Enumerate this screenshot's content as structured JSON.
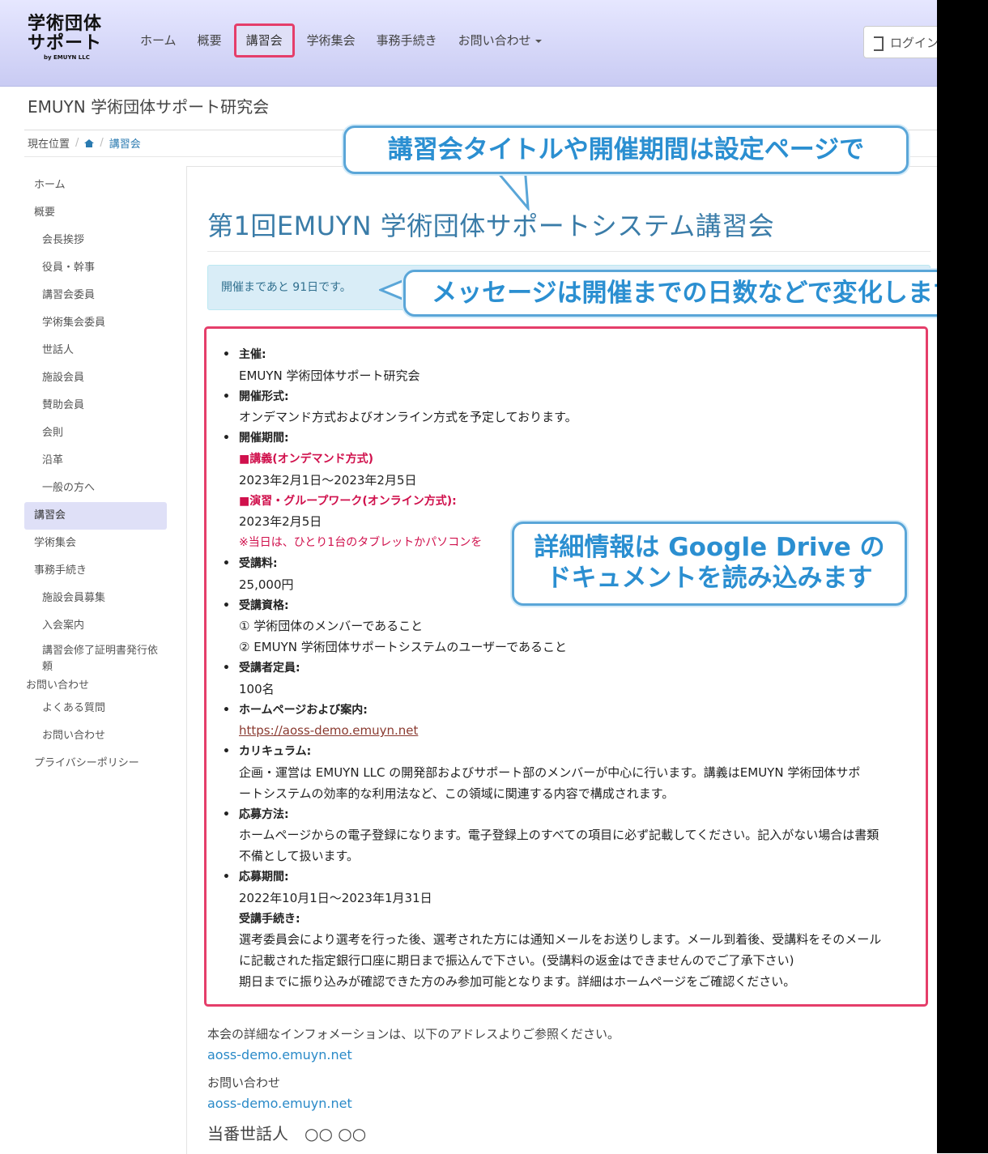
{
  "navbar": {
    "logo_line1": "学術団体",
    "logo_line2": "サポート",
    "logo_line3": "by EMUYN LLC",
    "items": [
      "ホーム",
      "概要",
      "講習会",
      "学術集会",
      "事務手続き",
      "お問い合わせ"
    ],
    "active_item": "講習会",
    "login_label": "ログイン"
  },
  "site_title": "EMUYN 学術団体サポート研究会",
  "breadcrumb": {
    "current_label": "現在位置",
    "page": "講習会"
  },
  "sidebar": {
    "items": [
      "ホーム",
      "概要",
      "会長挨拶",
      "役員・幹事",
      "講習会委員",
      "学術集会委員",
      "世話人",
      "施設会員",
      "賛助会員",
      "会則",
      "沿革",
      "一般の方へ",
      "講習会",
      "学術集会",
      "事務手続き",
      "施設会員募集",
      "入会案内",
      "講習会修了証明書発行依頼",
      "お問い合わせ",
      "よくある質問",
      "お問い合わせ",
      "プライバシーポリシー"
    ]
  },
  "page_title": "第1回EMUYN 学術団体サポートシステム講習会",
  "alert_message": "開催まであと 91日です。",
  "details": {
    "host_label": "主催:",
    "host": "EMUYN 学術団体サポート研究会",
    "format_label": "開催形式:",
    "format": "オンデマンド方式およびオンライン方式を予定しております。",
    "period_label": "開催期間:",
    "lecture_label": "■講義(オンデマンド方式)",
    "lecture_dates": "2023年2月1日～2023年2月5日",
    "workshop_label": "■演習・グループワーク(オンライン方式):",
    "workshop_date": "2023年2月5日",
    "note": "※当日は、ひとり1台のタブレットかパソコンを",
    "fee_label": "受講料:",
    "fee": "25,000円",
    "qualification_label": "受講資格:",
    "qualification_1": "① 学術団体のメンバーであること",
    "qualification_2": "② EMUYN 学術団体サポートシステムのユーザーであること",
    "capacity_label": "受講者定員:",
    "capacity": "100名",
    "homepage_label": "ホームページおよび案内:",
    "homepage_url": "https://aoss-demo.emuyn.net",
    "curriculum_label": "カリキュラム:",
    "curriculum_1": "企画・運営は EMUYN LLC の開発部およびサポート部のメンバーが中心に行います。講義はEMUYN 学術団体サポ",
    "curriculum_2": "ートシステムの効率的な利用法など、この領域に関連する内容で構成されます。",
    "apply_label": "応募方法:",
    "apply_1": "ホームページからの電子登録になります。電子登録上のすべての項目に必ず記載してください。記入がない場合は書類",
    "apply_2": "不備として扱います。",
    "apply_period_label": "応募期間:",
    "apply_period": "2022年10月1日～2023年1月31日",
    "procedure_label": "受講手続き:",
    "procedure_1": "選考委員会により選考を行った後、選考された方には通知メールをお送りします。メール到着後、受講料をそのメール",
    "procedure_2": "に記載された指定銀行口座に期日まで振込んで下さい。(受講料の返金はできませんのでご了承下さい)",
    "procedure_3": "期日までに振り込みが確認できた方のみ参加可能となります。詳細はホームページをご確認ください。"
  },
  "footer": {
    "info_text": "本会の詳細なインフォメーションは、以下のアドレスよりご参照ください。",
    "info_link": "aoss-demo.emuyn.net",
    "contact_label": "お問い合わせ",
    "contact_link": "aoss-demo.emuyn.net",
    "duty": "当番世話人　○○ ○○"
  },
  "callouts": {
    "title_note": "講習会タイトルや開催期間は設定ページで",
    "message_note": "メッセージは開催までの日数などで変化します",
    "details_note_1": "詳細情報は Google  Drive の",
    "details_note_2": "ドキュメントを読み込みます"
  },
  "colors": {
    "accent": "#3a7ca8",
    "highlight_border": "#e53e6a",
    "callout": "#2b8fd1",
    "alert_bg": "#d9edf7"
  }
}
